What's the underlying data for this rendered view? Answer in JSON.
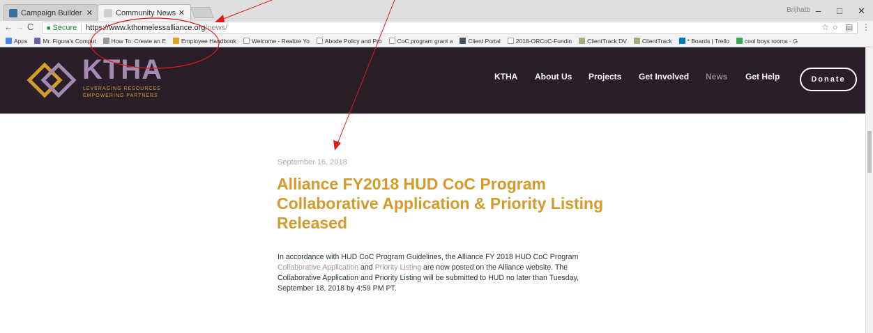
{
  "browser": {
    "tabs": [
      {
        "title": "Campaign Builder - Tem",
        "favicon_color": "#3a6ea5"
      },
      {
        "title": "Community News — Kin",
        "favicon_color": "#cfcfcf"
      }
    ],
    "profile_name": "Brijhatb",
    "window_controls": {
      "minimize": "–",
      "maximize": "□",
      "close": "✕"
    },
    "url_secure_label": "Secure",
    "url_host": "https://www.kthomelessalliance.org",
    "url_path": "/news/",
    "bookmarks": [
      {
        "label": "Apps",
        "color": "#4285f4"
      },
      {
        "label": "Mr. Figura's Comput",
        "color": "#66a"
      },
      {
        "label": "How To: Create an E",
        "color": "#999"
      },
      {
        "label": "Employee Handbook",
        "color": "#e0a020"
      },
      {
        "label": "Welcome - Realize Yo",
        "color": "#bbb"
      },
      {
        "label": "Abode Policy and Pro",
        "color": "#bbb"
      },
      {
        "label": "CoC program grant a",
        "color": "#bbb"
      },
      {
        "label": "Client Portal",
        "color": "#456"
      },
      {
        "label": "2018-ORCoC-Fundin",
        "color": "#bbb"
      },
      {
        "label": "ClientTrack DV",
        "color": "#aa7"
      },
      {
        "label": "ClientTrack",
        "color": "#aa7"
      },
      {
        "label": "* Boards | Trello",
        "color": "#0079bf"
      },
      {
        "label": "cool boys rooms - G",
        "color": "#34a853"
      }
    ]
  },
  "site": {
    "logo_text": "KTHA",
    "logo_tag_line1": "LEVERAGING RESOURCES",
    "logo_tag_line2": "EMPOWERING PARTNERS",
    "nav": [
      "KTHA",
      "About Us",
      "Projects",
      "Get Involved",
      "News",
      "Get Help"
    ],
    "donate_label": "Donate",
    "colors": {
      "header_bg": "#2a1f28",
      "gold": "#d39a2c",
      "purple": "#a48bb4"
    }
  },
  "article": {
    "date": "September 16, 2018",
    "title": "Alliance FY2018 HUD CoC Program Collaborative Application & Priority Listing Released",
    "body_part1": "In accordance with HUD CoC Program Guidelines, the Alliance FY 2018 HUD CoC Program ",
    "link1": "Collaborative Application",
    "body_part2": " and ",
    "link2": "Priority Listing",
    "body_part3": " are now posted on the Alliance website. The Collaborative Application and Priority Listing will be submitted to HUD no later than Tuesday, September 18, 2018 by 4:59 PM PT."
  }
}
